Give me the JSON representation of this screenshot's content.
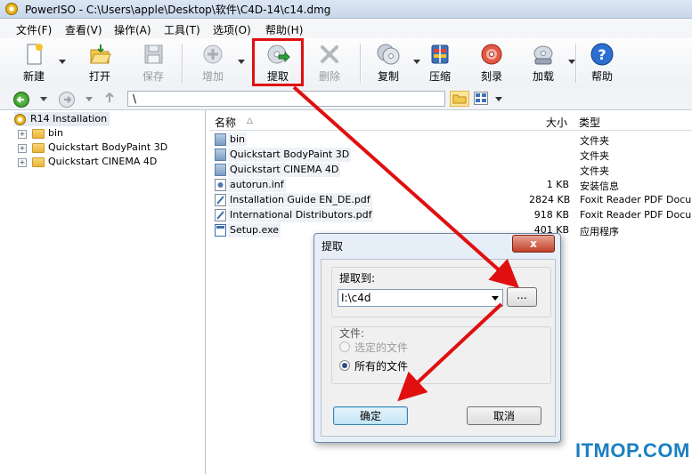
{
  "window": {
    "title": "PowerISO - C:\\Users\\apple\\Desktop\\软件\\C4D-14\\c14.dmg"
  },
  "menu": [
    {
      "label": "文件(F)"
    },
    {
      "label": "查看(V)"
    },
    {
      "label": "操作(A)"
    },
    {
      "label": "工具(T)"
    },
    {
      "label": "选项(O)"
    },
    {
      "label": "帮助(H)"
    }
  ],
  "toolbar": {
    "new": "新建",
    "open": "打开",
    "save": "保存",
    "add": "增加",
    "extract": "提取",
    "delete": "删除",
    "copy": "复制",
    "compress": "压缩",
    "burn": "刻录",
    "mount": "加载",
    "help": "帮助"
  },
  "address": {
    "path": "\\"
  },
  "tree": {
    "root": "R14 Installation",
    "children": [
      "bin",
      "Quickstart BodyPaint 3D",
      "Quickstart CINEMA 4D"
    ]
  },
  "list": {
    "columns": {
      "name": "名称",
      "size": "大小",
      "type": "类型"
    },
    "rows": [
      {
        "name": "bin",
        "size": "",
        "type": "文件夹"
      },
      {
        "name": "Quickstart BodyPaint 3D",
        "size": "",
        "type": "文件夹"
      },
      {
        "name": "Quickstart CINEMA 4D",
        "size": "",
        "type": "文件夹"
      },
      {
        "name": "autorun.inf",
        "size": "1 KB",
        "type": "安装信息"
      },
      {
        "name": "Installation Guide EN_DE.pdf",
        "size": "2824 KB",
        "type": "Foxit Reader PDF Documen"
      },
      {
        "name": "International Distributors.pdf",
        "size": "918 KB",
        "type": "Foxit Reader PDF Documen"
      },
      {
        "name": "Setup.exe",
        "size": "401 KB",
        "type": "应用程序"
      }
    ]
  },
  "dialog": {
    "title": "提取",
    "close": "x",
    "extract_to_label": "提取到:",
    "path_value": "I:\\c4d",
    "browse": "...",
    "files_label": "文件:",
    "option_selected": "选定的文件",
    "option_all": "所有的文件",
    "ok": "确定",
    "cancel": "取消"
  },
  "watermark": "ITMOP.COM",
  "colors": {
    "annotation": "#e01010",
    "watermark": "#1a7fc2"
  }
}
